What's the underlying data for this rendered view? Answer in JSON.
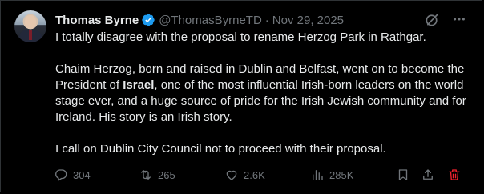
{
  "author": {
    "name": "Thomas Byrne",
    "handle": "@ThomasByrneTD",
    "date": "Nov 29, 2025",
    "separator": "·",
    "avatar_icon": "profile-photo",
    "verified_icon": "verified-badge-icon"
  },
  "post": {
    "line1": "I totally disagree with the proposal to rename Herzog Park in Rathgar.",
    "p2_before": "Chaim Herzog, born and raised in Dublin and Belfast, went on to become the President of ",
    "p2_bold": "Israel",
    "p2_after": ", one of the most influential Irish-born leaders on the world stage ever, and a huge source of pride for the Irish Jewish community and for Ireland.   His story is an Irish story.",
    "p3": "I call on Dublin City Council not to proceed with their proposal."
  },
  "stats": {
    "replies": "304",
    "reposts": "265",
    "likes": "2.6K",
    "views": "285K"
  },
  "colors": {
    "background": "#000000",
    "text": "#e7e9ea",
    "muted": "#71767b",
    "verified": "#1d9bf0",
    "delete": "#f4212e"
  }
}
